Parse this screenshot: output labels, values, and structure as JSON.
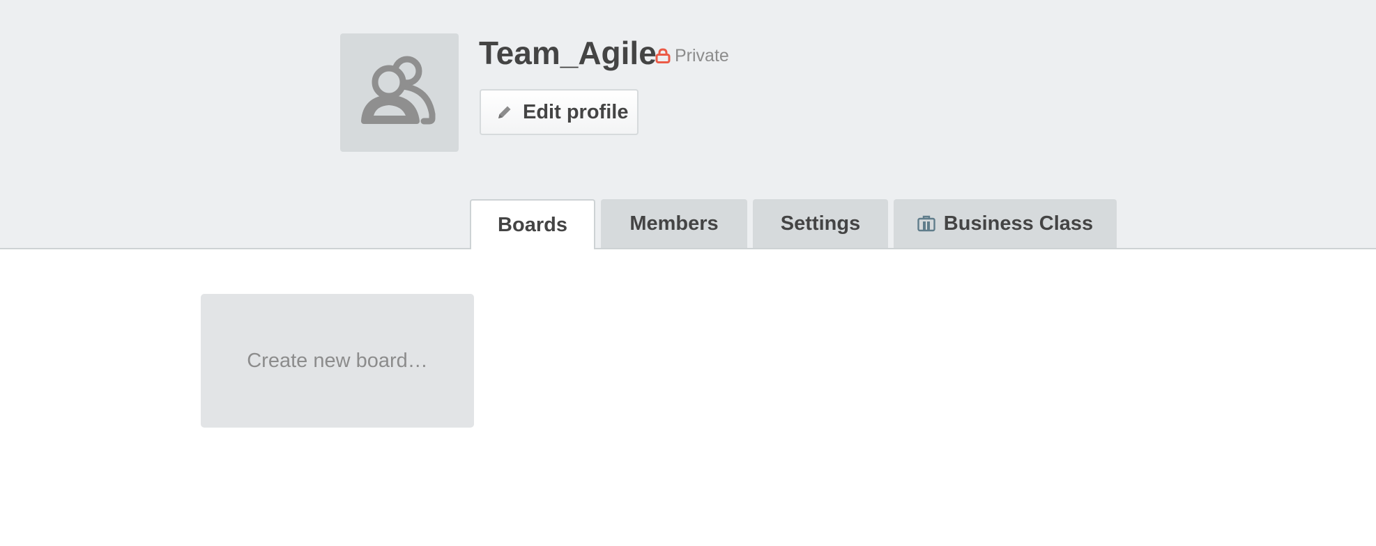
{
  "team": {
    "name": "Team_Agile",
    "privacy": "Private",
    "avatar_icon": "team-icon"
  },
  "actions": {
    "edit_profile": "Edit profile",
    "edit_icon": "pencil-icon"
  },
  "tabs": [
    {
      "label": "Boards",
      "active": true
    },
    {
      "label": "Members",
      "active": false
    },
    {
      "label": "Settings",
      "active": false
    },
    {
      "label": "Business Class",
      "active": false,
      "icon": "briefcase-icon"
    }
  ],
  "boards": {
    "create_label": "Create new board…"
  },
  "colors": {
    "header_bg": "#edeff1",
    "lock": "#eb5a46",
    "text_dark": "#444444",
    "text_muted": "#8c8c8c",
    "tab_bg": "#d6dadc",
    "briefcase": "#607d8b"
  }
}
